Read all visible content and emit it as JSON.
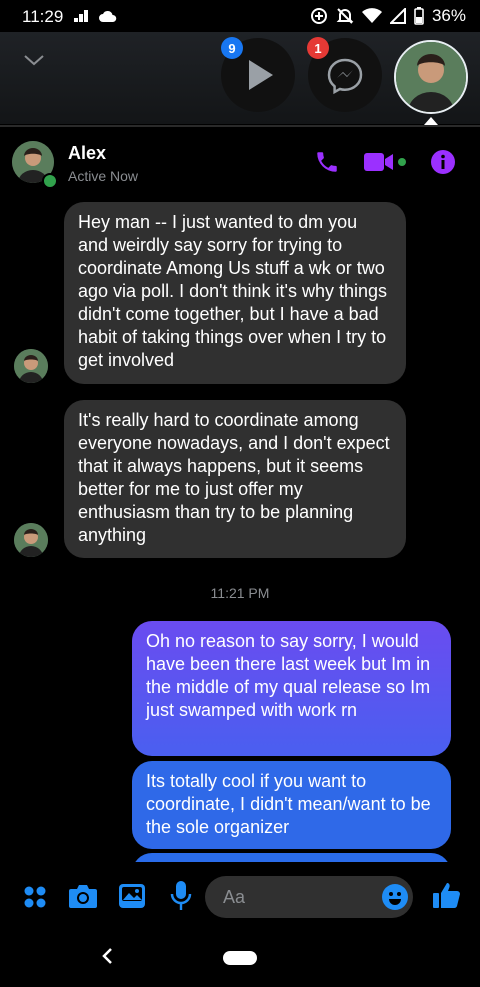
{
  "status_bar": {
    "time": "11:29",
    "battery": "36%"
  },
  "bubble_tray": {
    "video_badge": "9",
    "messenger_badge": "1"
  },
  "header": {
    "name": "Alex",
    "status": "Active Now"
  },
  "messages": [
    {
      "direction": "incoming",
      "text": "Hey man -- I just wanted to dm you and weirdly say sorry for trying to coordinate Among Us stuff a wk or two ago via poll. I don't think it's why things didn't come together, but I have a bad habit of taking things over when I try to get involved"
    },
    {
      "direction": "incoming",
      "text": "It's really hard to coordinate among everyone nowadays, and I don't expect that it always happens, but it seems better for me to just offer my enthusiasm than try to be planning anything"
    },
    {
      "direction": "outgoing",
      "text": "Oh no reason to say sorry, I would have been there last week but Im in the middle of my qual release so Im just swamped with work rn"
    },
    {
      "direction": "outgoing",
      "text": "Its totally cool if you want to coordinate, I didn't mean/want to be the sole organizer"
    }
  ],
  "timestamp": "11:21 PM",
  "composer": {
    "placeholder": "Aa"
  },
  "colors": {
    "accent": "#9b30ff",
    "blue_icon": "#1e8cf5",
    "online": "#31a24c"
  },
  "icons": [
    "signal-icon",
    "cloud-icon",
    "data-saver-icon",
    "do-not-disturb-icon",
    "wifi-icon",
    "cell-signal-icon",
    "battery-icon",
    "chevron-down-icon",
    "play-icon",
    "messenger-icon",
    "phone-icon",
    "video-camera-icon",
    "info-icon",
    "apps-icon",
    "camera-icon",
    "gallery-icon",
    "microphone-icon",
    "emoji-icon",
    "thumbs-up-icon",
    "back-icon",
    "home-pill"
  ]
}
